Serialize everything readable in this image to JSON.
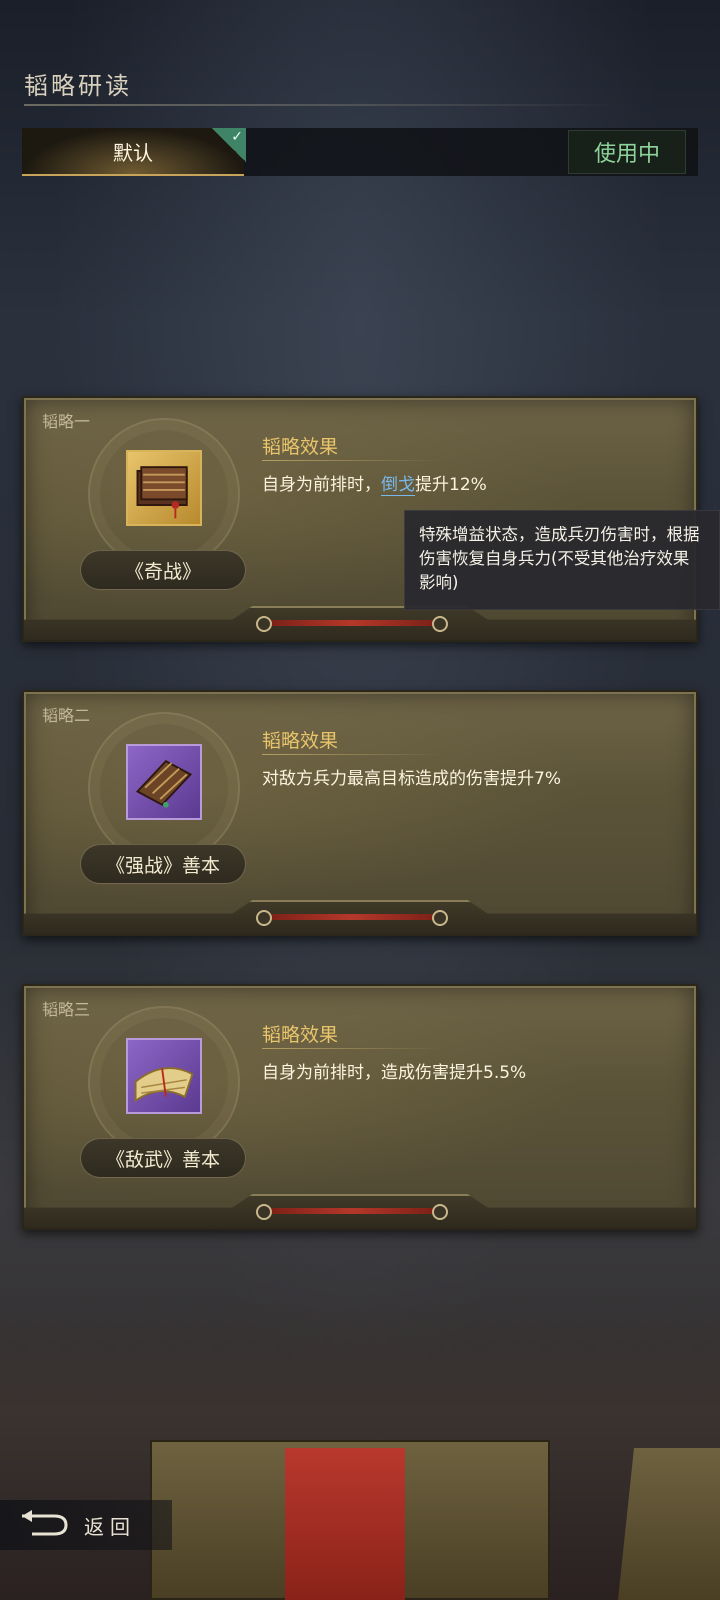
{
  "header": {
    "title": "韬略研读"
  },
  "tabs": {
    "active_label": "默认",
    "status_label": "使用中"
  },
  "cards": [
    {
      "tag": "韬略一",
      "book_name": "《奇战》",
      "effect_title": "韬略效果",
      "effect_prefix": "自身为前排时，",
      "effect_link": "倒戈",
      "effect_suffix": "提升12%",
      "rarity": "gold"
    },
    {
      "tag": "韬略二",
      "book_name": "《强战》善本",
      "effect_title": "韬略效果",
      "effect_text": "对敌方兵力最高目标造成的伤害提升7%",
      "rarity": "purple"
    },
    {
      "tag": "韬略三",
      "book_name": "《敌武》善本",
      "effect_title": "韬略效果",
      "effect_text": "自身为前排时，造成伤害提升5.5%",
      "rarity": "purple"
    }
  ],
  "tooltip": {
    "text": "特殊增益状态，造成兵刃伤害时，根据伤害恢复自身兵力(不受其他治疗效果影响)"
  },
  "footer": {
    "back_label": "返回"
  },
  "colors": {
    "accent_gold": "#e8c46b",
    "link_blue": "#79b8ea",
    "in_use_green": "#8ed49a"
  }
}
